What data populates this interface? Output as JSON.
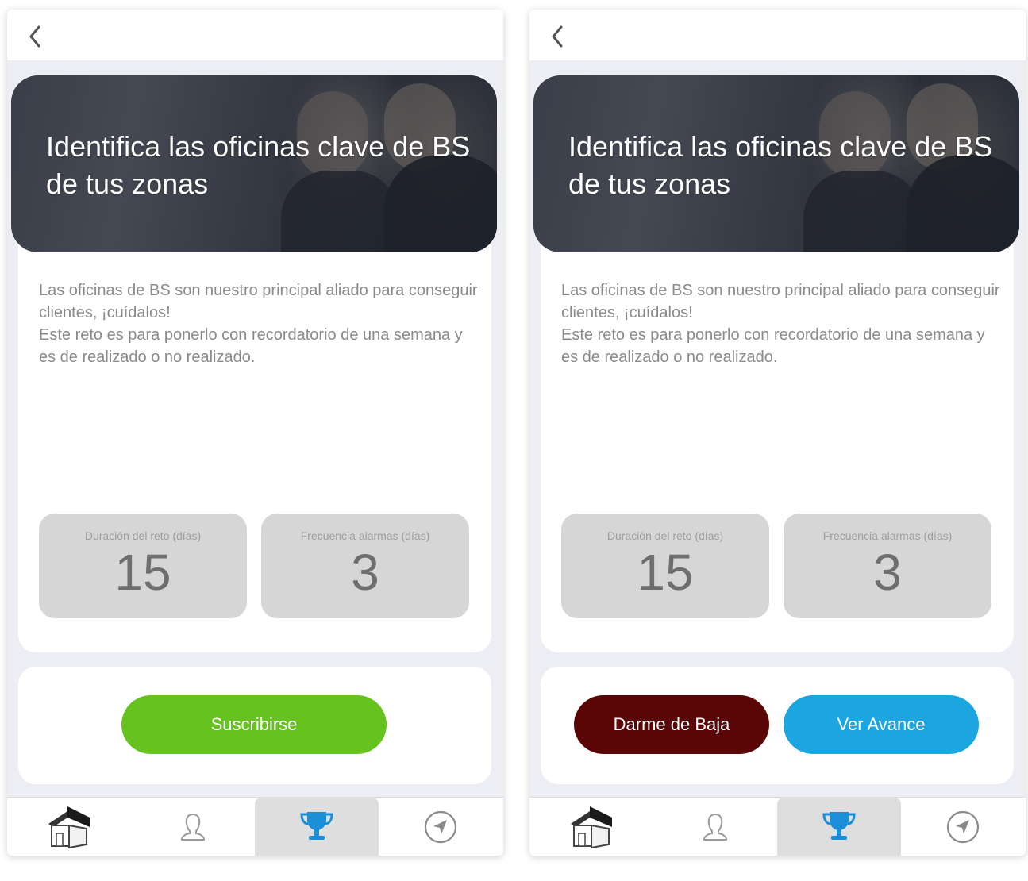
{
  "screens": [
    {
      "header": {
        "back_icon": "chevron-left-icon"
      },
      "challenge": {
        "title": "Identifica las oficinas clave de BS de tus zonas",
        "description_line1": "Las oficinas de BS son nuestro principal aliado para conseguir clientes, ¡cuídalos!",
        "description_line2": "Este reto es para ponerlo con recordatorio de una semana y es de realizado o no realizado."
      },
      "stats": {
        "duration_label": "Duración del reto (días)",
        "duration_value": "15",
        "frequency_label": "Frecuencia alarmas (días)",
        "frequency_value": "3"
      },
      "actions": {
        "subscribe_label": "Suscribirse",
        "subscribe_color": "#66c21e"
      },
      "tabbar": {
        "tabs": [
          "home-icon",
          "user-icon",
          "trophy-icon",
          "location-arrow-icon"
        ],
        "active": "trophy-icon"
      }
    },
    {
      "header": {
        "back_icon": "chevron-left-icon"
      },
      "challenge": {
        "title": "Identifica las oficinas clave de BS de tus zonas",
        "description_line1": "Las oficinas de BS son nuestro principal aliado para conseguir clientes, ¡cuídalos!",
        "description_line2": "Este reto es para ponerlo con recordatorio de una semana y es de realizado o no realizado."
      },
      "stats": {
        "duration_label": "Duración del reto (días)",
        "duration_value": "15",
        "frequency_label": "Frecuencia alarmas (días)",
        "frequency_value": "3"
      },
      "actions": {
        "unsubscribe_label": "Darme de Baja",
        "unsubscribe_color": "#5a0606",
        "progress_label": "Ver Avance",
        "progress_color": "#1ba6e0"
      },
      "tabbar": {
        "tabs": [
          "home-icon",
          "user-icon",
          "trophy-icon",
          "location-arrow-icon"
        ],
        "active": "trophy-icon"
      }
    }
  ]
}
